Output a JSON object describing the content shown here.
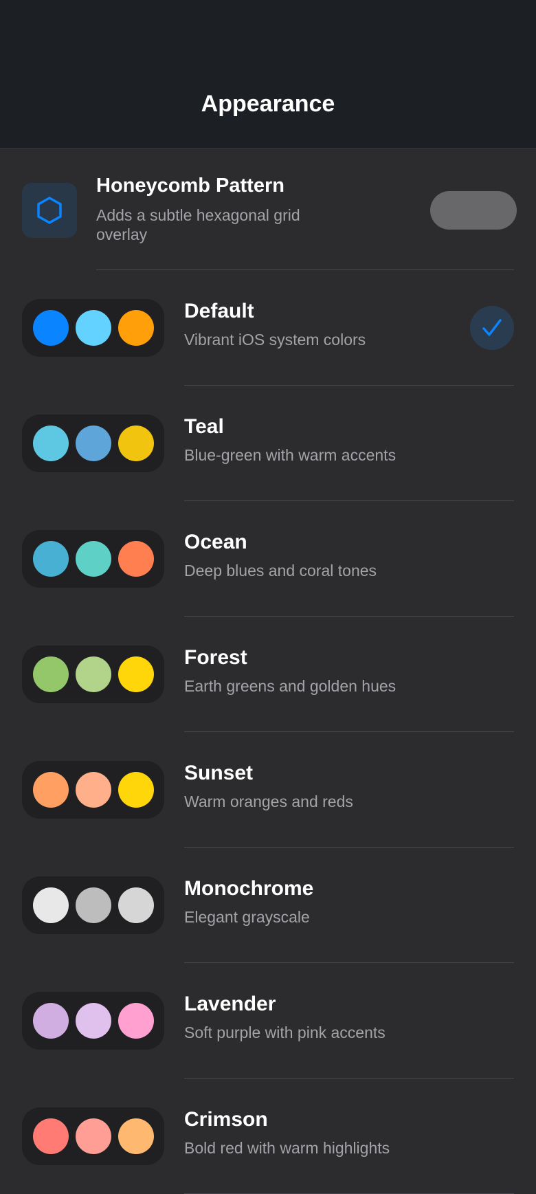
{
  "header": {
    "title": "Appearance"
  },
  "honeycomb": {
    "title": "Honeycomb Pattern",
    "description": "Adds a subtle hexagonal grid overlay",
    "icon": "hexagon-icon",
    "toggle_on": false,
    "icon_color": "#0a84ff"
  },
  "themes": [
    {
      "name": "Default",
      "description": "Vibrant iOS system colors",
      "colors": [
        "#0a84ff",
        "#64d2ff",
        "#ff9f0a"
      ],
      "selected": true
    },
    {
      "name": "Teal",
      "description": "Blue-green with warm accents",
      "colors": [
        "#5ec8e3",
        "#5ea5d9",
        "#f1c40f"
      ],
      "selected": false
    },
    {
      "name": "Ocean",
      "description": "Deep blues and coral tones",
      "colors": [
        "#48b1d3",
        "#5fd0c6",
        "#ff7f50"
      ],
      "selected": false
    },
    {
      "name": "Forest",
      "description": "Earth greens and golden hues",
      "colors": [
        "#94c66a",
        "#b2d38a",
        "#ffd60a"
      ],
      "selected": false
    },
    {
      "name": "Sunset",
      "description": "Warm oranges and reds",
      "colors": [
        "#ff9f62",
        "#ffb08a",
        "#ffd60a"
      ],
      "selected": false
    },
    {
      "name": "Monochrome",
      "description": "Elegant grayscale",
      "colors": [
        "#e8e8e8",
        "#bdbdbd",
        "#d6d6d6"
      ],
      "selected": false
    },
    {
      "name": "Lavender",
      "description": "Soft purple with pink accents",
      "colors": [
        "#d0aee2",
        "#e0c0ec",
        "#ffa0d0"
      ],
      "selected": false
    },
    {
      "name": "Crimson",
      "description": "Bold red with warm highlights",
      "colors": [
        "#ff7b74",
        "#ff9e95",
        "#ffb870"
      ],
      "selected": false
    }
  ]
}
